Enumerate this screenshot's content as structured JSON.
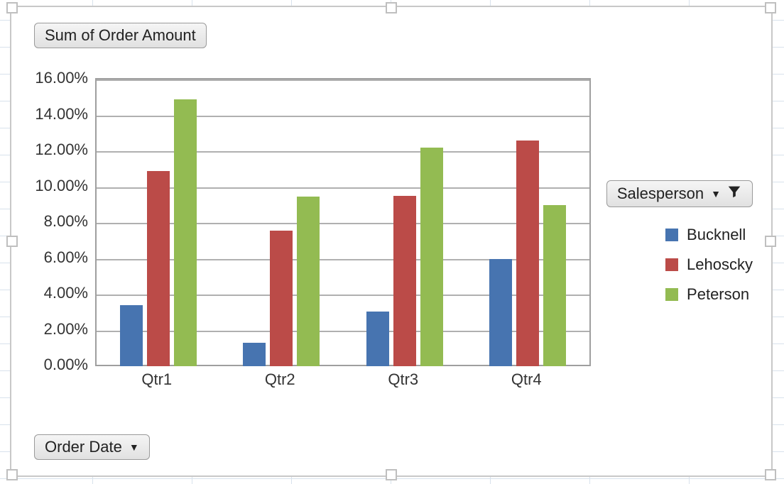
{
  "buttons": {
    "values_field": "Sum of Order Amount",
    "axis_field": "Order Date",
    "legend_field": "Salesperson"
  },
  "chart_data": {
    "type": "bar",
    "title": "",
    "xlabel": "",
    "ylabel": "",
    "ylim": [
      0,
      16
    ],
    "y_format": "percent_2dp",
    "y_ticks": [
      "0.00%",
      "2.00%",
      "4.00%",
      "6.00%",
      "8.00%",
      "10.00%",
      "12.00%",
      "14.00%",
      "16.00%"
    ],
    "categories": [
      "Qtr1",
      "Qtr2",
      "Qtr3",
      "Qtr4"
    ],
    "series": [
      {
        "name": "Bucknell",
        "color": "#4774b0",
        "values": [
          3.4,
          1.3,
          3.05,
          6.0
        ]
      },
      {
        "name": "Lehoscky",
        "color": "#bb4b48",
        "values": [
          10.9,
          7.55,
          9.5,
          12.6
        ]
      },
      {
        "name": "Peterson",
        "color": "#93bb52",
        "values": [
          14.9,
          9.45,
          12.2,
          9.0
        ]
      }
    ]
  }
}
